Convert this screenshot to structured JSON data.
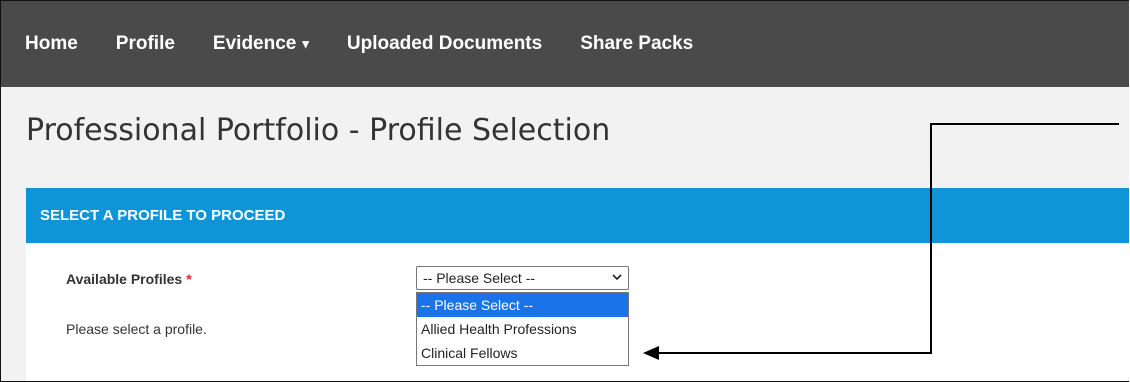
{
  "nav": {
    "items": [
      {
        "label": "Home"
      },
      {
        "label": "Profile"
      },
      {
        "label": "Evidence"
      },
      {
        "label": "Uploaded Documents"
      },
      {
        "label": "Share Packs"
      }
    ],
    "evidence_caret": "▾"
  },
  "page": {
    "title": "Professional Portfolio - Profile Selection"
  },
  "panel": {
    "header": "SELECT A PROFILE TO PROCEED",
    "field_label": "Available Profiles",
    "required_mark": "*",
    "helper_text": "Please select a profile.",
    "select": {
      "value": "-- Please Select --",
      "options": [
        "-- Please Select --",
        "Allied Health Professions",
        "Clinical Fellows"
      ],
      "highlighted_option": "-- Please Select --"
    }
  },
  "colors": {
    "navbar": "#4a4a4a",
    "panel_header": "#0d95d8",
    "selected_option": "#1a73e8",
    "required": "#d9232e"
  }
}
